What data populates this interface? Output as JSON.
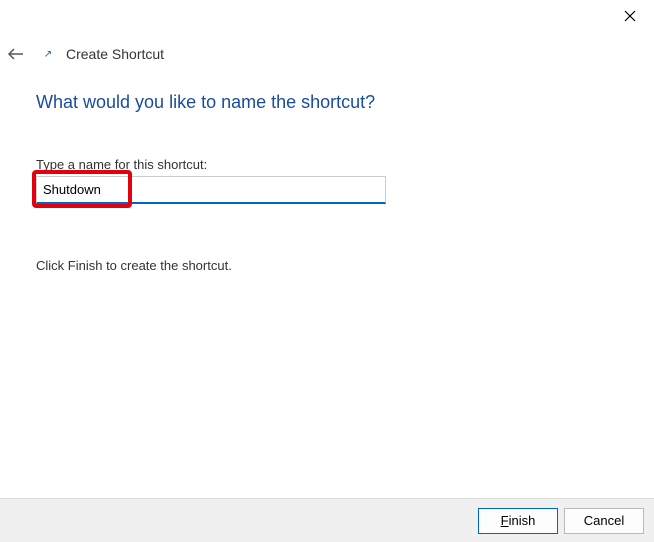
{
  "window": {
    "title": "Create Shortcut"
  },
  "main": {
    "heading": "What would you like to name the shortcut?",
    "field_label": "Type a name for this shortcut:",
    "name_value": "Shutdown",
    "instruction": "Click Finish to create the shortcut."
  },
  "footer": {
    "finish_prefix": "F",
    "finish_rest": "inish",
    "cancel": "Cancel"
  }
}
